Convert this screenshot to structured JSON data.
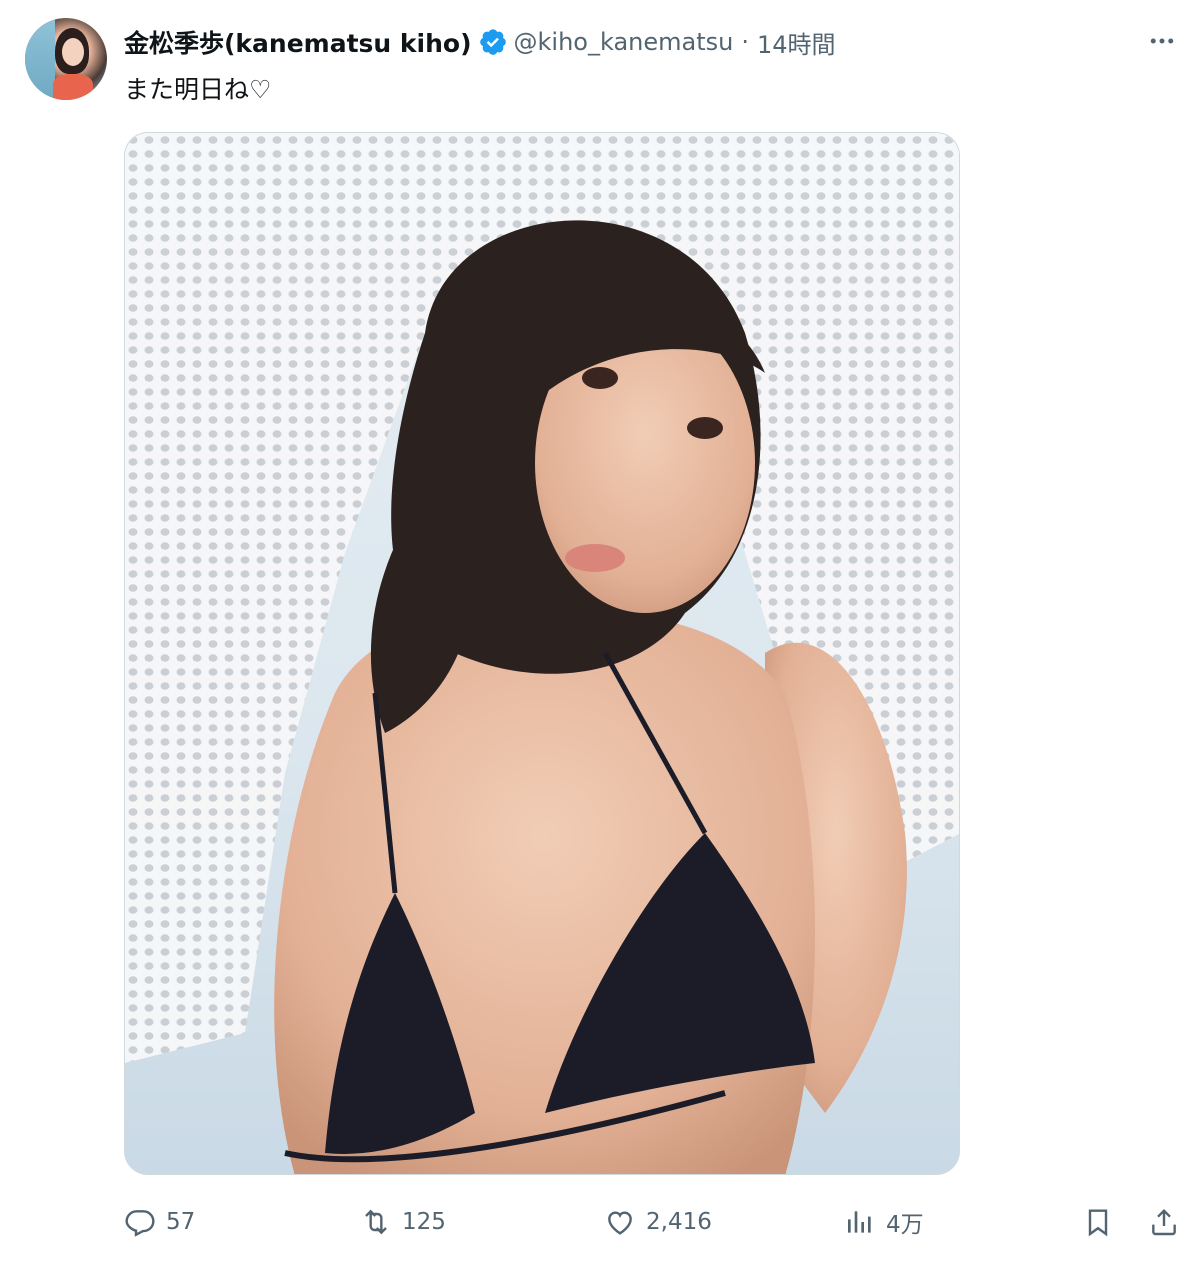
{
  "author": {
    "display_name": "金松季歩(kanematsu kiho)",
    "handle": "@kiho_kanematsu",
    "separator": "·",
    "time": "14時間",
    "verified": true,
    "verified_color": "#1d9bf0"
  },
  "tweet": {
    "text": "また明日ね♡"
  },
  "actions": {
    "reply": {
      "icon": "reply-icon",
      "count": "57"
    },
    "retweet": {
      "icon": "retweet-icon",
      "count": "125"
    },
    "like": {
      "icon": "heart-icon",
      "count": "2,416"
    },
    "views": {
      "icon": "views-icon",
      "count": "4万"
    },
    "bookmark": {
      "icon": "bookmark-icon"
    },
    "share": {
      "icon": "share-icon"
    }
  },
  "colors": {
    "text_primary": "#0f1419",
    "text_secondary": "#536471",
    "border": "#cfd9de"
  }
}
